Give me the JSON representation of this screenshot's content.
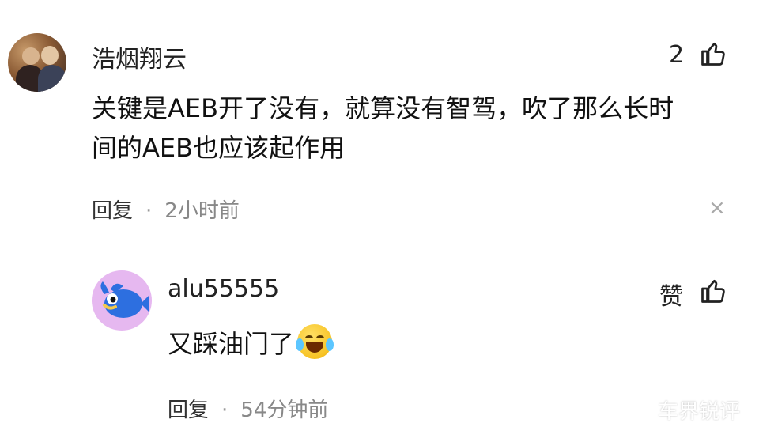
{
  "main_comment": {
    "username": "浩烟翔云",
    "like_count": "2",
    "text_line1": "关键是AEB开了没有，就算没有智驾，吹了那么长时",
    "text_line2": "间的AEB也应该起作用",
    "reply_label": "回复",
    "dot": "·",
    "time": "2小时前",
    "close_glyph": "×"
  },
  "reply_comment": {
    "username": "alu55555",
    "like_label": "赞",
    "text": "又踩油门了",
    "emoji": "crying-laughing-emoji",
    "reply_label": "回复",
    "dot": "·",
    "time": "54分钟前"
  },
  "watermark": {
    "text": "车界锐评",
    "icon": "wechat-icon"
  },
  "colors": {
    "background": "#ffffff",
    "text": "#111111",
    "muted": "#888888",
    "reply_avatar_bg": "#e6b8f0",
    "fish": "#2d6fe0"
  }
}
